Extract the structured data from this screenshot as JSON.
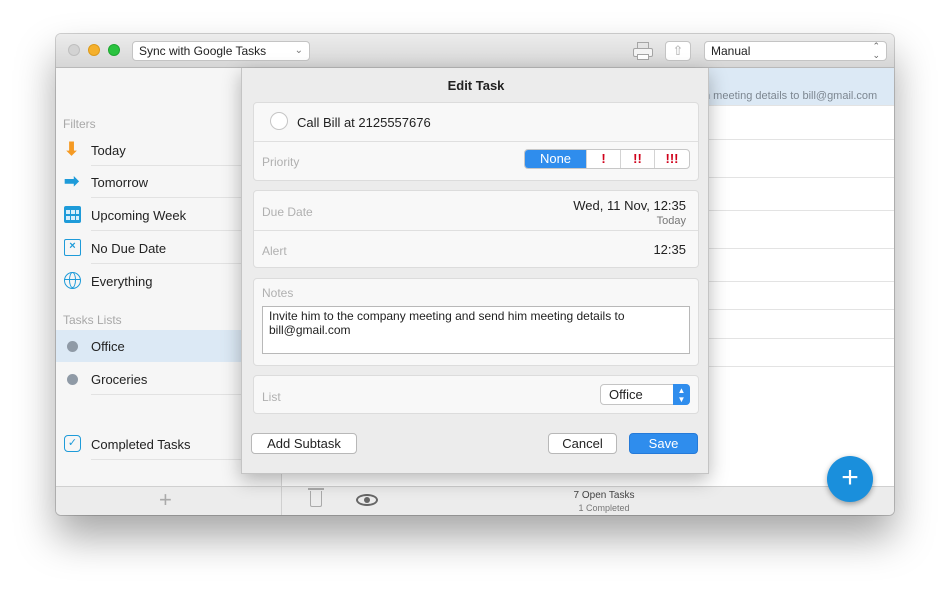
{
  "toolbar": {
    "sync_label": "Sync with Google Tasks",
    "sort_label": "Manual"
  },
  "sidebar": {
    "filters_label": "Filters",
    "filters": [
      {
        "label": "Today",
        "icon": "arrow-down-icon",
        "color": "#f59a23"
      },
      {
        "label": "Tomorrow",
        "icon": "arrow-right-icon",
        "color": "#1e9bd9"
      },
      {
        "label": "Upcoming Week",
        "icon": "calendar-grid-icon",
        "color": "#1e9bd9"
      },
      {
        "label": "No Due Date",
        "icon": "calendar-x-icon",
        "color": "#1e9bd9"
      },
      {
        "label": "Everything",
        "icon": "globe-icon",
        "color": "#1e9bd9"
      }
    ],
    "lists_label": "Tasks Lists",
    "lists": [
      {
        "label": "Office",
        "color": "#8f9aa6",
        "selected": true
      },
      {
        "label": "Groceries",
        "color": "#8f9aa6",
        "selected": false
      }
    ],
    "completed_label": "Completed Tasks",
    "add_glyph": "+"
  },
  "main": {
    "selected_row_text": "n meeting details to bill@gmail.com",
    "open_tasks": "7 Open Tasks",
    "completed": "1 Completed",
    "add_glyph": "+"
  },
  "edit_task": {
    "title": "Edit Task",
    "task_name": "Call Bill at 2125557676",
    "priority_label": "Priority",
    "priority_options": [
      "None",
      "!",
      "!!",
      "!!!"
    ],
    "priority_selected": "None",
    "due_date_label": "Due Date",
    "due_date_value": "Wed, 11 Nov, 12:35",
    "due_date_sub": "Today",
    "alert_label": "Alert",
    "alert_value": "12:35",
    "notes_label": "Notes",
    "notes_text": "Invite him to the company meeting and send him meeting details to bill@gmail.com",
    "list_label": "List",
    "list_value": "Office",
    "add_subtask_label": "Add Subtask",
    "cancel_label": "Cancel",
    "save_label": "Save"
  },
  "colors": {
    "accent": "#2f8ded",
    "selection": "#dce9f5",
    "priority_red": "#d0021b",
    "fab": "#1a8fdc"
  }
}
